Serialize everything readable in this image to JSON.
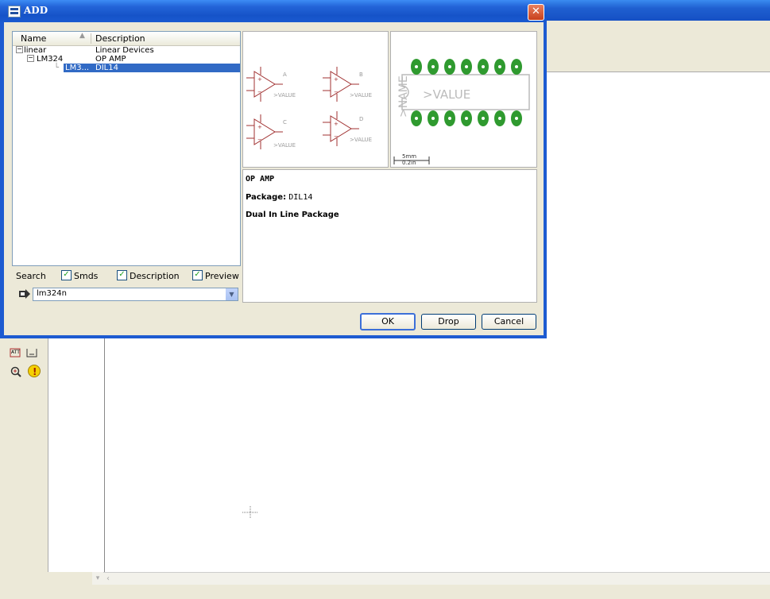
{
  "dialog": {
    "title": "ADD",
    "close_glyph": "✕"
  },
  "tree": {
    "headers": {
      "name": "Name",
      "description": "Description"
    },
    "rows": [
      {
        "name": "linear",
        "description": "Linear Devices",
        "expander": "−"
      },
      {
        "name": "LM324",
        "description": "OP AMP",
        "expander": "−"
      },
      {
        "name": "LM3...",
        "description": "DIL14"
      }
    ]
  },
  "search": {
    "label": "Search",
    "smds_label": "Smds",
    "description_label": "Description",
    "preview_label": "Preview",
    "input_value": "lm324n",
    "checkmark": "✓"
  },
  "symbol_preview": {
    "gates": [
      "A",
      "B",
      "C",
      "D"
    ],
    "value_text": ">VALUE"
  },
  "package_preview": {
    "name_text": ">NAME",
    "value_text": ">VALUE",
    "scale_mm": "5mm",
    "scale_in": "0.2in"
  },
  "info": {
    "heading": "OP AMP",
    "package_label": "Package:",
    "package_value": "DIL14",
    "package_desc": "Dual In Line Package"
  },
  "buttons": {
    "ok": "OK",
    "drop": "Drop",
    "cancel": "Cancel"
  },
  "colors": {
    "titlebar": "#1d5bd1",
    "selection": "#316ac5",
    "schematic_red": "#a03030",
    "pad_green": "#2f9a2f"
  }
}
